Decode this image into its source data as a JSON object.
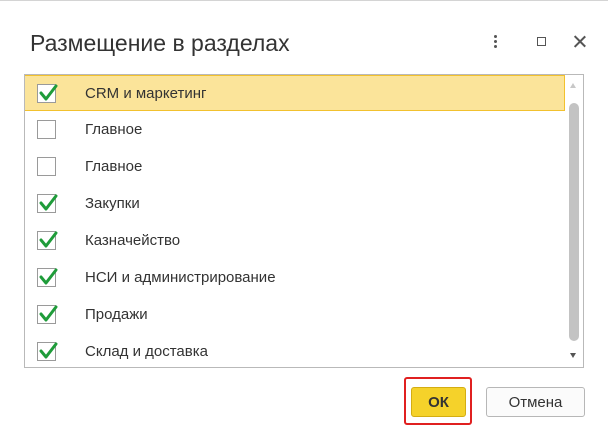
{
  "dialog": {
    "title": "Размещение в разделах"
  },
  "list": {
    "items": [
      {
        "label": "CRM и маркетинг",
        "checked": true,
        "selected": true
      },
      {
        "label": "Главное",
        "checked": false,
        "selected": false
      },
      {
        "label": "Главное",
        "checked": false,
        "selected": false
      },
      {
        "label": "Закупки",
        "checked": true,
        "selected": false
      },
      {
        "label": "Казначейство",
        "checked": true,
        "selected": false
      },
      {
        "label": "НСИ и администрирование",
        "checked": true,
        "selected": false
      },
      {
        "label": "Продажи",
        "checked": true,
        "selected": false
      },
      {
        "label": "Склад и доставка",
        "checked": true,
        "selected": false
      }
    ]
  },
  "buttons": {
    "ok_label": "ОК",
    "cancel_label": "Отмена"
  },
  "colors": {
    "selected_row": "#fbe49a",
    "check_mark": "#1f9c3a",
    "ok_button": "#f5d22a",
    "highlight_frame": "#e02020"
  }
}
